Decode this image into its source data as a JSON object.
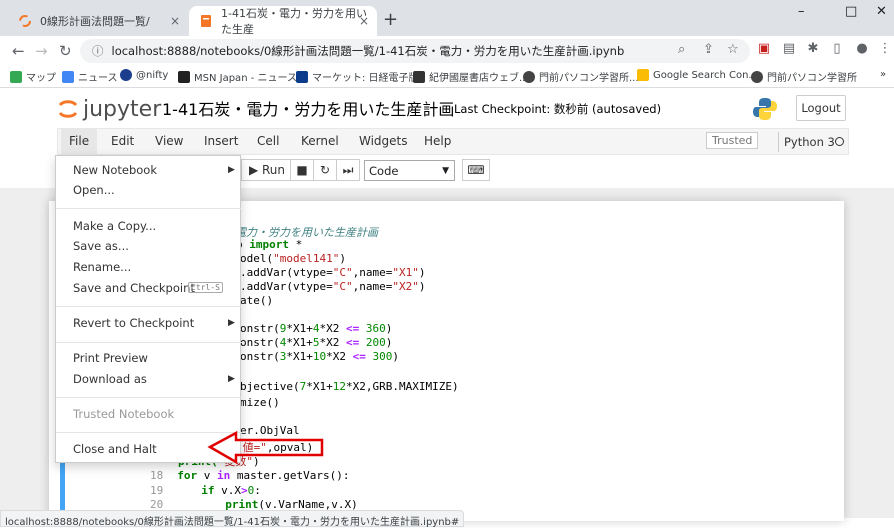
{
  "browser": {
    "tabs": [
      {
        "title": "0線形計画法問題一覧/",
        "close": "×"
      },
      {
        "title": "1-41石炭・電力・労力を用いた生産",
        "close": "×"
      }
    ],
    "new_tab": "+",
    "window_controls": {
      "minimize": "–",
      "restore": "□",
      "close": "✕"
    },
    "url": "localhost:8888/notebooks/0線形計画法問題一覧/1-41石炭・電力・労力を用いた生産計画.ipynb",
    "bookmarks": [
      "マップ",
      "ニュース",
      "@nifty",
      "MSN Japan - ニュース...",
      "マーケット: 日経電子版",
      "紀伊國屋書店ウェブ...",
      "門前パソコン学習所...",
      "Google Search Con...",
      "門前パソコン学習所"
    ],
    "status_url": "localhost:8888/notebooks/0線形計画法問題一覧/1-41石炭・電力・労力を用いた生産計画.ipynb#"
  },
  "jupyter": {
    "logo_text": "jupyter",
    "notebook_title": "1-41石炭・電力・労力を用いた生産計画",
    "checkpoint": "Last Checkpoint: 数秒前  (autosaved)",
    "logout": "Logout",
    "menus": [
      "File",
      "Edit",
      "View",
      "Insert",
      "Cell",
      "Kernel",
      "Widgets",
      "Help"
    ],
    "trusted": "Trusted",
    "kernel": "Python 3",
    "toolbar": {
      "run": "▶ Run",
      "cell_type": "Code"
    }
  },
  "file_menu": {
    "new_notebook": "New Notebook",
    "open": "Open...",
    "make_copy": "Make a Copy...",
    "save_as": "Save as...",
    "rename": "Rename...",
    "save_checkpoint": "Save and Checkpoint",
    "save_shortcut": "Ctrl-S",
    "revert": "Revert to Checkpoint",
    "print_preview": "Print Preview",
    "download_as": "Download as",
    "trusted_notebook": "Trusted Notebook",
    "close_halt": "Close and Halt"
  },
  "code_lines": {
    "l1": "・電力・労力を用いた生産計画",
    "l2a": "p ",
    "l2b": "import",
    "l2c": " *",
    "l3a": "odel(",
    "l3b": "\"model141\"",
    "l3c": ")",
    "l4a": ".addVar(vtype=",
    "l4b": "\"C\"",
    "l4c": ",name=",
    "l4d": "\"X1\"",
    "l4e": ")",
    "l5a": ".addVar(vtype=",
    "l5b": "\"C\"",
    "l5c": ",name=",
    "l5d": "\"X2\"",
    "l5e": ")",
    "l6": "ate()",
    "l8a": "onstr(",
    "l8b": "9",
    "l8c": "*X1+",
    "l8d": "4",
    "l8e": "*X2 ",
    "l8f": "<=",
    "l8g": " 360",
    "l8h": ")",
    "l9a": "onstr(",
    "l9b": "4",
    "l9c": "*X1+",
    "l9d": "5",
    "l9e": "*X2 ",
    "l9f": "<=",
    "l9g": " 200",
    "l9h": ")",
    "l10a": "onstr(",
    "l10b": "3",
    "l10c": "*X1+",
    "l10d": "10",
    "l10e": "*X2 ",
    "l10f": "<=",
    "l10g": " 300",
    "l10h": ")",
    "l12a": "bjective(",
    "l12b": "7",
    "l12c": "*X1+",
    "l12d": "12",
    "l12e": "*X2,GRB.MAXIMIZE)",
    "l13": "mize()",
    "l15": "er.ObjVal",
    "l16a": "\"値=\"",
    "l16b": ",opval)",
    "l17a": "print(",
    "l17b": "\"変数\"",
    "l17c": ")",
    "n18": "18",
    "l18a": "for",
    "l18b": " v ",
    "l18c": "in",
    "l18d": " master.getVars():",
    "n19": "19",
    "l19a": "if",
    "l19b": " v.X",
    "l19c": ">",
    "l19d": "0",
    "l19e": ":",
    "n20": "20",
    "l20a": "print",
    "l20b": "(v.VarName,v.X)"
  }
}
